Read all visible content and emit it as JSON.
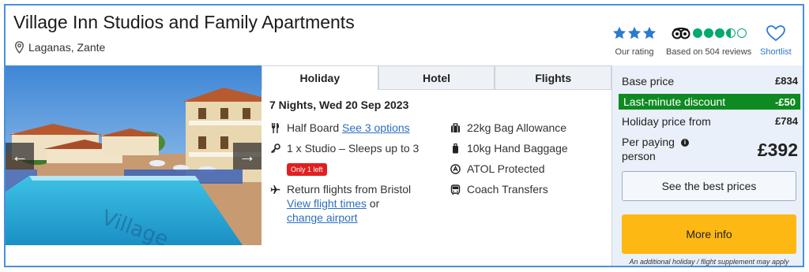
{
  "hotel": {
    "name": "Village Inn Studios and Family Apartments",
    "location": "Laganas, Zante"
  },
  "ratings": {
    "our_rating_stars": 3,
    "our_rating_label": "Our rating",
    "tripadvisor_score": 3.5,
    "tripadvisor_label": "Based on 504 reviews",
    "shortlist_label": "Shortlist"
  },
  "tabs": [
    {
      "label": "Holiday",
      "active": true
    },
    {
      "label": "Hotel",
      "active": false
    },
    {
      "label": "Flights",
      "active": false
    }
  ],
  "gallery": {
    "prev_icon": "←",
    "next_icon": "→"
  },
  "holiday": {
    "dates": "7 Nights, Wed 20 Sep 2023",
    "board": "Half Board",
    "board_link": "See 3 options",
    "room": "1 x Studio – Sleeps up to 3",
    "room_badge": "Only 1 left",
    "flights_text": "Return flights from Bristol",
    "flight_times_link": "View flight times",
    "or_text": "or",
    "change_airport_link": "change airport",
    "bag_allowance": "22kg Bag Allowance",
    "hand_baggage": "10kg Hand Baggage",
    "atol": "ATOL Protected",
    "transfers": "Coach Transfers"
  },
  "pricing": {
    "base_price_label": "Base price",
    "base_price": "£834",
    "discount_label": "Last-minute discount",
    "discount": "-£50",
    "from_label": "Holiday price from",
    "from_price": "£784",
    "per_person_label_1": "Per paying",
    "per_person_label_2": "person",
    "per_person_price": "£392",
    "info_icon": "i",
    "best_prices_button": "See the best prices",
    "more_info_button": "More info",
    "disclaimer": "An additional holiday / flight supplement may apply"
  },
  "colors": {
    "accent_blue": "#2b7bd0",
    "discount_green": "#0f8a22",
    "cta_yellow": "#fdb813",
    "tripadvisor_green": "#00aa6c",
    "badge_red": "#e02020"
  },
  "icons": {
    "location": "map-pin-icon",
    "board": "cutlery-icon",
    "room": "key-icon",
    "flights": "plane-icon",
    "bag": "suitcase-icon",
    "hand_baggage": "hand-luggage-icon",
    "atol": "atol-icon",
    "transfers": "coach-icon",
    "shortlist": "heart-icon",
    "info": "info-icon"
  }
}
